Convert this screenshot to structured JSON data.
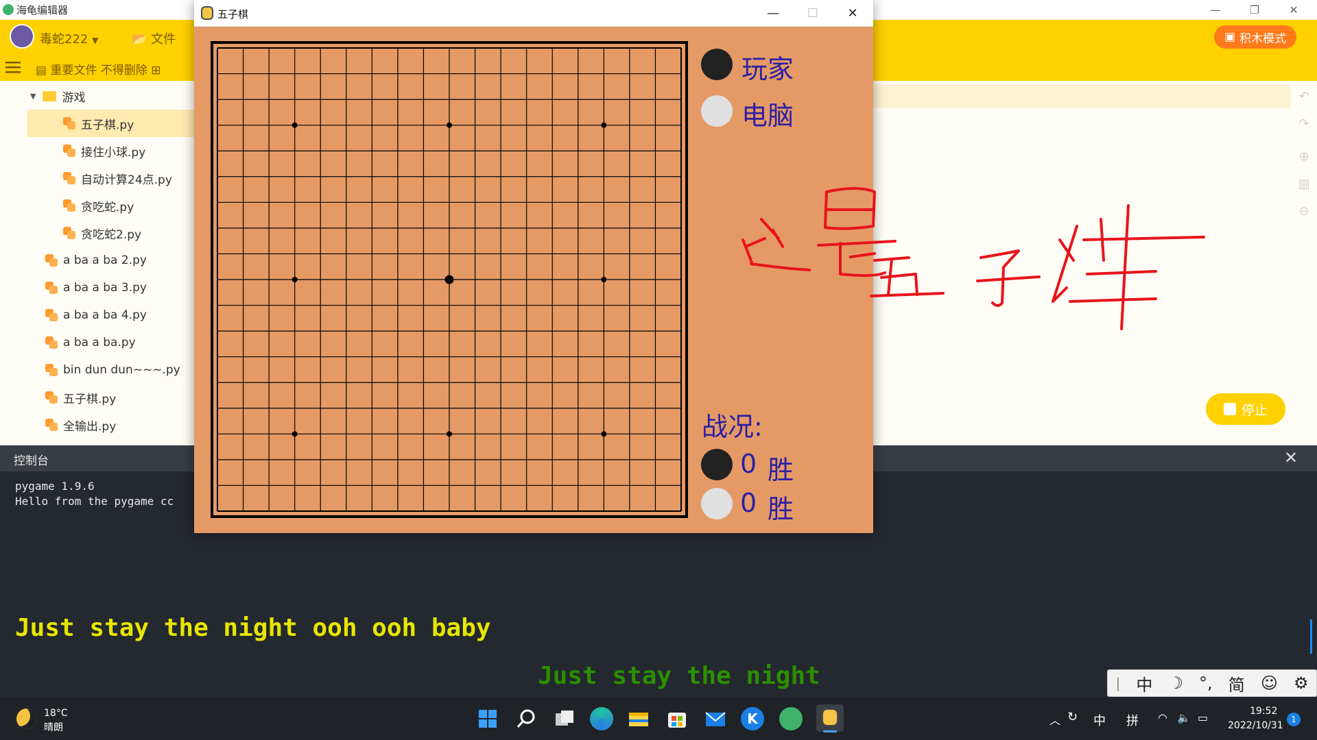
{
  "editor": {
    "app_title": "海龟编辑器",
    "user_name": "毒蛇222",
    "file_menu": "文件",
    "mode_button": "积木模式",
    "project_name": "重要文件 不得删除",
    "stop_button": "停止"
  },
  "sidebar": {
    "folder": "游戏",
    "folder_items": [
      "五子棋.py",
      "接住小球.py",
      "自动计算24点.py",
      "贪吃蛇.py",
      "贪吃蛇2.py"
    ],
    "root_items": [
      "a ba a ba 2.py",
      "a ba a ba 3.py",
      "a ba a ba 4.py",
      "a ba a ba.py",
      "bin dun dun~~~.py",
      "五子棋.py",
      "全输出.py"
    ]
  },
  "console": {
    "title": "控制台",
    "lines": [
      "pygame 1.9.6",
      "Hello from the pygame cc"
    ]
  },
  "lyrics": {
    "line1": "Just stay the night ooh ooh baby",
    "line2": "Just stay the night"
  },
  "ime": {
    "items": [
      "中",
      "☽",
      "°,",
      "简",
      "☺",
      "⚙"
    ]
  },
  "taskbar": {
    "temperature": "18°C",
    "weather": "晴朗",
    "tray_lang": "中",
    "tray_input": "拼",
    "time": "19:52",
    "date": "2022/10/31",
    "notification_count": "1"
  },
  "game": {
    "window_title": "五子棋",
    "player_label": "玩家",
    "computer_label": "电脑",
    "record_title": "战况:",
    "player_wins": "0",
    "computer_wins": "0",
    "wins_label": "胜",
    "board_lines": 19,
    "star_points": [
      [
        3,
        3
      ],
      [
        9,
        3
      ],
      [
        15,
        3
      ],
      [
        3,
        9
      ],
      [
        9,
        9
      ],
      [
        15,
        9
      ],
      [
        3,
        15
      ],
      [
        9,
        15
      ],
      [
        15,
        15
      ]
    ],
    "center_point": [
      9,
      9
    ],
    "colors": {
      "background": "#e59a66",
      "line": "#000000",
      "text": "#2c1fa3",
      "handwriting": "#e8141c"
    }
  }
}
